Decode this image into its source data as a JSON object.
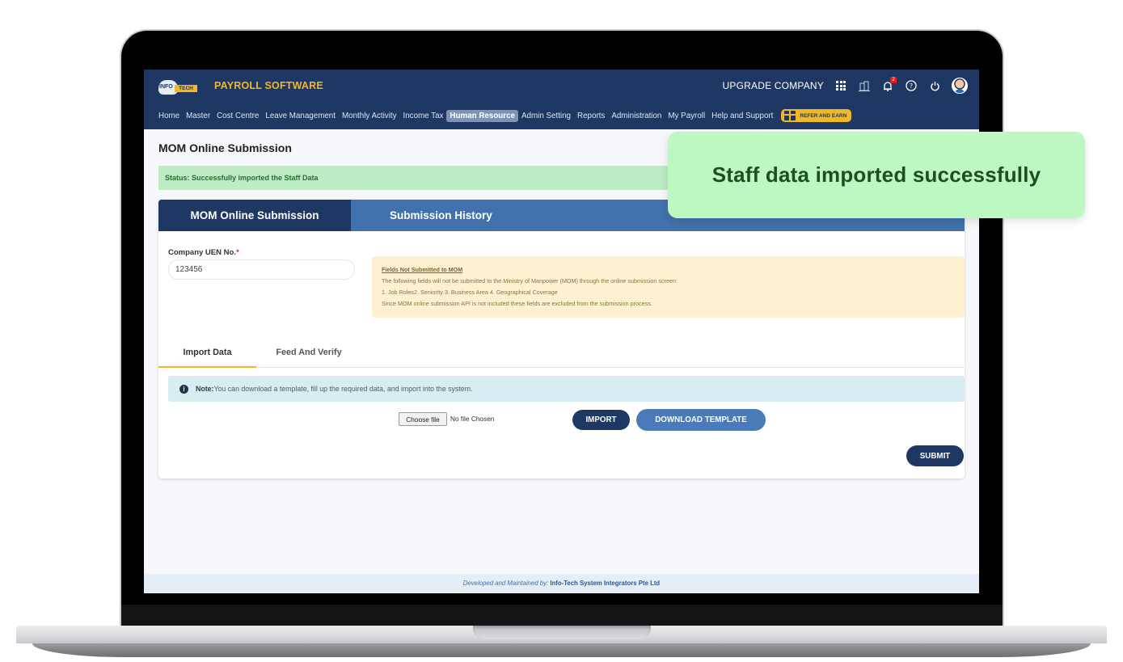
{
  "header": {
    "logo_text_left": "INFO",
    "logo_text_right": "TECH",
    "app_title": "PAYROLL SOFTWARE",
    "upgrade_label": "UPGRADE COMPANY",
    "notification_count": "2",
    "icons": [
      "apps-grid-icon",
      "building-icon",
      "bell-icon",
      "help-icon",
      "power-icon",
      "avatar"
    ]
  },
  "nav": {
    "items": [
      {
        "label": "Home"
      },
      {
        "label": "Master"
      },
      {
        "label": "Cost Centre"
      },
      {
        "label": "Leave Management"
      },
      {
        "label": "Monthly Activity"
      },
      {
        "label": "Income Tax"
      },
      {
        "label": "Human Resource",
        "active": true
      },
      {
        "label": "Admin Setting"
      },
      {
        "label": "Reports"
      },
      {
        "label": "Administration"
      },
      {
        "label": "My Payroll"
      },
      {
        "label": "Help and Support"
      }
    ],
    "refer_label": "REFER AND EARN"
  },
  "page": {
    "title": "MOM Online Submission",
    "status": "Status: Successfully imported the Staff Data"
  },
  "tabs": {
    "main": "MOM Online Submission",
    "history": "Submission History"
  },
  "form": {
    "uen_label": "Company UEN No.",
    "uen_required": "*",
    "uen_value": "123456"
  },
  "notice": {
    "heading": "Fields Not Submitted to MOM",
    "line1": "The following fields will not be submitted to the Ministry of Manpower (MOM) through the online submission screen:",
    "line2": "1. Job Roles2. Seniority 3. Business Area 4. Geographical Coverage",
    "line3": "Since MOM online submission API is not included these fields are excluded from the submission process."
  },
  "subtabs": {
    "import": "Import Data",
    "feed": "Feed And Verify"
  },
  "note": {
    "label": "Note:",
    "text": "You can download a template, fill up the required data, and import into the system."
  },
  "import": {
    "choose_file": "Choose file",
    "file_name": "No file Chosen",
    "import_button": "IMPORT",
    "download_button": "DOWNLOAD TEMPLATE",
    "submit_button": "SUBMIT"
  },
  "footer": {
    "prefix": "Developed and Maintained by:",
    "company": "Info-Tech System Integrators Pte Ltd"
  },
  "toast": {
    "message": "Staff data imported successfully"
  },
  "colors": {
    "primary": "#1e3763",
    "accent": "#f2b824",
    "secondary": "#4272ad",
    "success_bg": "#bdecc5",
    "toast_bg": "#bdf7c1"
  }
}
